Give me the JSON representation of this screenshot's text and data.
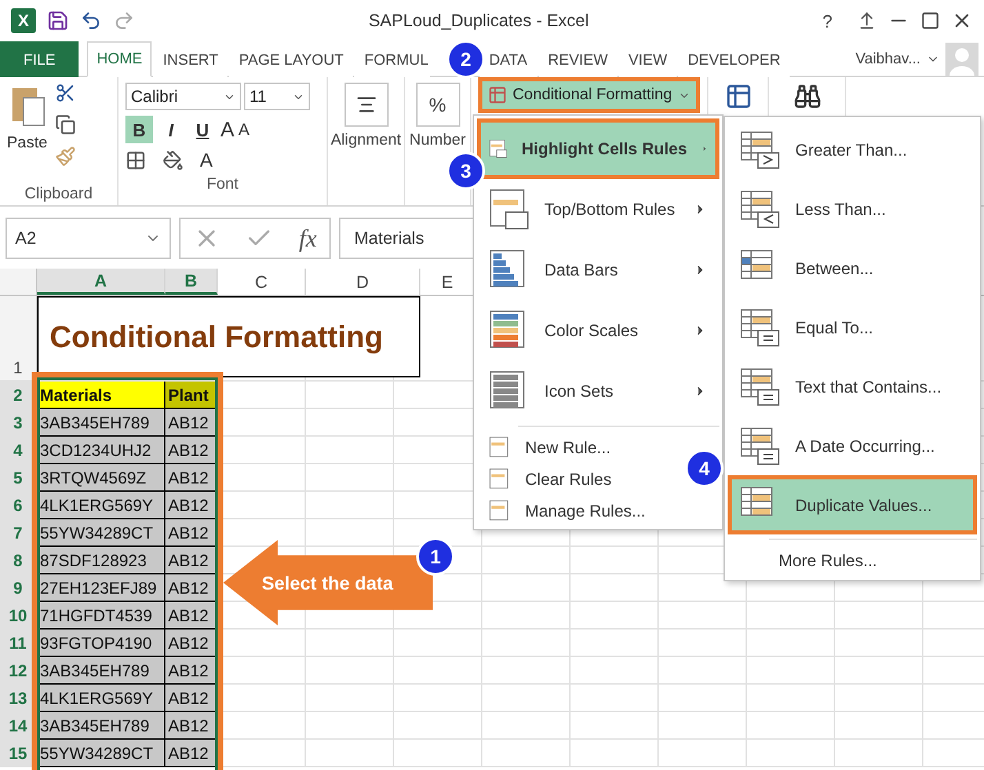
{
  "window": {
    "logo": "X",
    "title": "SAPLoud_Duplicates - Excel",
    "help": "?",
    "user": "Vaibhav..."
  },
  "ribbon_tabs": [
    {
      "label": "FILE",
      "kind": "file",
      "selected": false
    },
    {
      "label": "HOME",
      "kind": "tab",
      "selected": true
    },
    {
      "label": "INSERT",
      "kind": "tab",
      "selected": false
    },
    {
      "label": "PAGE LAYOUT",
      "kind": "tab",
      "selected": false
    },
    {
      "label": "FORMUL",
      "kind": "tab",
      "selected": false
    },
    {
      "label": "DATA",
      "kind": "tab",
      "selected": false
    },
    {
      "label": "REVIEW",
      "kind": "tab",
      "selected": false
    },
    {
      "label": "VIEW",
      "kind": "tab",
      "selected": false
    },
    {
      "label": "DEVELOPER",
      "kind": "tab",
      "selected": false
    }
  ],
  "ribbon": {
    "paste": "Paste",
    "clipboard_group": "Clipboard",
    "font_group": "Font",
    "font_name": "Calibri",
    "font_size": "11",
    "style_buttons": [
      {
        "label": "B",
        "selected": true
      },
      {
        "label": "I",
        "selected": false
      },
      {
        "label": "U",
        "selected": false
      }
    ],
    "grow_font": "A",
    "shrink_font": "A",
    "font_color": "A",
    "alignment": "Alignment",
    "number_symbol": "%",
    "number": "Number",
    "conditional_formatting": "Conditional Formatting"
  },
  "formula_bar": {
    "name_box": "A2",
    "fx": "fx",
    "value": "Materials"
  },
  "columns": [
    {
      "label": "A",
      "selected": true
    },
    {
      "label": "B",
      "selected": true
    },
    {
      "label": "C",
      "selected": false
    },
    {
      "label": "D",
      "selected": false
    },
    {
      "label": "E",
      "selected": false
    }
  ],
  "title_row": {
    "number": "1",
    "text": "Conditional Formatting"
  },
  "table": {
    "header_row": "2",
    "header": [
      "Materials",
      "Plant"
    ],
    "rows": [
      {
        "number": "3",
        "cells": [
          "3AB345EH789",
          "AB12"
        ]
      },
      {
        "number": "4",
        "cells": [
          "3CD1234UHJ2",
          "AB12"
        ]
      },
      {
        "number": "5",
        "cells": [
          "3RTQW4569Z",
          "AB12"
        ]
      },
      {
        "number": "6",
        "cells": [
          "4LK1ERG569Y",
          "AB12"
        ]
      },
      {
        "number": "7",
        "cells": [
          "55YW34289CT",
          "AB12"
        ]
      },
      {
        "number": "8",
        "cells": [
          "87SDF128923",
          "AB12"
        ]
      },
      {
        "number": "9",
        "cells": [
          "27EH123EFJ89",
          "AB12"
        ]
      },
      {
        "number": "10",
        "cells": [
          "71HGFDT4539",
          "AB12"
        ]
      },
      {
        "number": "11",
        "cells": [
          "93FGTOP4190",
          "AB12"
        ]
      },
      {
        "number": "12",
        "cells": [
          "3AB345EH789",
          "AB12"
        ]
      },
      {
        "number": "13",
        "cells": [
          "4LK1ERG569Y",
          "AB12"
        ]
      },
      {
        "number": "14",
        "cells": [
          "3AB345EH789",
          "AB12"
        ]
      },
      {
        "number": "15",
        "cells": [
          "55YW34289CT",
          "AB12"
        ]
      }
    ]
  },
  "menu": {
    "items": [
      {
        "label": "Highlight Cells Rules",
        "kind": "submenu",
        "selected": true
      },
      {
        "label": "Top/Bottom Rules",
        "kind": "submenu",
        "selected": false
      },
      {
        "label": "Data Bars",
        "kind": "submenu",
        "selected": false
      },
      {
        "label": "Color Scales",
        "kind": "submenu",
        "selected": false
      },
      {
        "label": "Icon Sets",
        "kind": "submenu",
        "selected": false
      },
      {
        "label": "New Rule...",
        "kind": "command",
        "selected": false
      },
      {
        "label": "Clear Rules",
        "kind": "command",
        "selected": false
      },
      {
        "label": "Manage Rules...",
        "kind": "command",
        "selected": false
      }
    ]
  },
  "submenu": {
    "items": [
      {
        "label": "Greater Than...",
        "kind": "rule",
        "selected": false
      },
      {
        "label": "Less Than...",
        "kind": "rule",
        "selected": false
      },
      {
        "label": "Between...",
        "kind": "rule",
        "selected": false
      },
      {
        "label": "Equal To...",
        "kind": "rule",
        "selected": false
      },
      {
        "label": "Text that Contains...",
        "kind": "rule",
        "selected": false
      },
      {
        "label": "A Date Occurring...",
        "kind": "rule",
        "selected": false
      },
      {
        "label": "Duplicate Values...",
        "kind": "rule",
        "selected": true
      },
      {
        "label": "More Rules...",
        "kind": "command",
        "selected": false
      }
    ]
  },
  "callouts": [
    "1",
    "2",
    "3",
    "4"
  ],
  "arrow_label": "Select the data"
}
